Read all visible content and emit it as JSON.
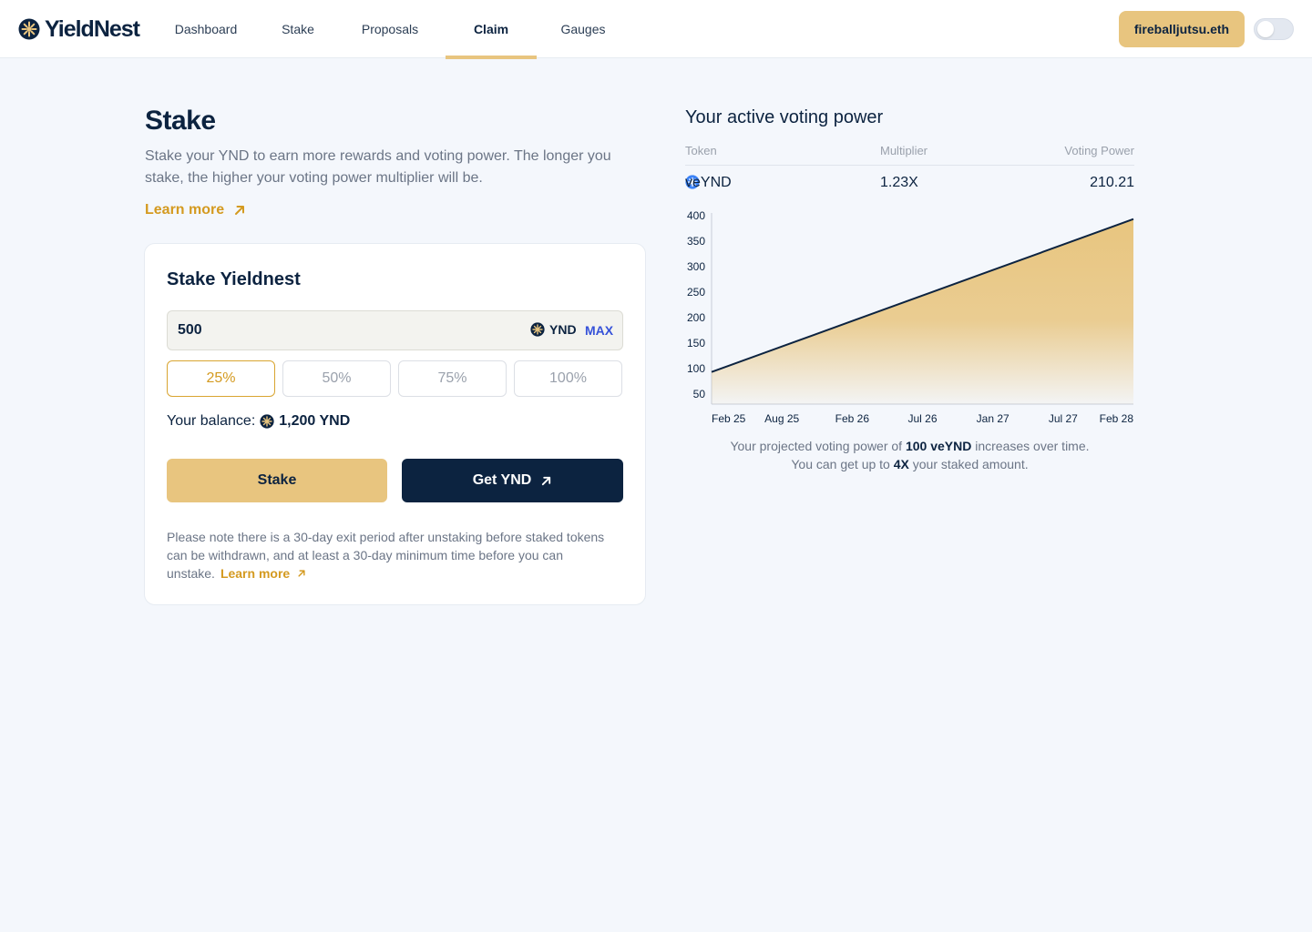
{
  "brand": {
    "name": "YieldNest"
  },
  "nav": {
    "items": [
      {
        "label": "Dashboard",
        "active": false
      },
      {
        "label": "Stake",
        "active": false
      },
      {
        "label": "Proposals",
        "active": false
      },
      {
        "label": "Claim",
        "active": true
      },
      {
        "label": "Gauges",
        "active": false
      }
    ]
  },
  "wallet": {
    "label": "fireballjutsu.eth"
  },
  "theme_toggle": {
    "on": false
  },
  "intro": {
    "title": "Stake",
    "description": "Stake your YND to earn more rewards and voting power. The longer you stake, the higher your voting power multiplier will be.",
    "learn_more": "Learn more"
  },
  "stake_card": {
    "title": "Stake Yieldnest",
    "amount": "500",
    "token": "YND",
    "max_label": "MAX",
    "percent_options": [
      "25%",
      "50%",
      "75%",
      "100%"
    ],
    "selected_percent": "25%",
    "balance_label": "Your balance:",
    "balance_value": "1,200 YND",
    "stake_button": "Stake",
    "get_button": "Get YND",
    "note": "Please note there is a 30-day exit period after unstaking before staked tokens can be withdrawn, and at least a 30-day minimum time before you can unstake.",
    "note_link": "Learn more"
  },
  "voting_power": {
    "title": "Your active voting power",
    "columns": [
      "Token",
      "Multiplier",
      "Voting Power"
    ],
    "row": {
      "token": "veYND",
      "multiplier": "1.23X",
      "power": "210.21"
    },
    "caption_pre": "Your projected voting power of",
    "caption_amount": "100 veYND",
    "caption_post": "increases over time.",
    "caption2_pre": "You can get up to",
    "caption2_mult": "4X",
    "caption2_post": "your staked amount."
  },
  "colors": {
    "accent": "#e8c57f",
    "navy": "#0c2340",
    "link": "#d49a20",
    "max": "#3652d9"
  },
  "chart_data": {
    "type": "area",
    "x": [
      "Feb 25",
      "Aug 25",
      "Feb 26",
      "Jul 26",
      "Jan 27",
      "Jul 27",
      "Feb 28"
    ],
    "values": [
      93,
      143,
      193,
      243,
      293,
      343,
      393
    ],
    "ylim": [
      30,
      405
    ],
    "yticks": [
      50,
      100,
      150,
      200,
      250,
      300,
      350,
      400
    ],
    "grid": false,
    "line_color": "#0c2340",
    "fill_color": "#e8c57f"
  }
}
